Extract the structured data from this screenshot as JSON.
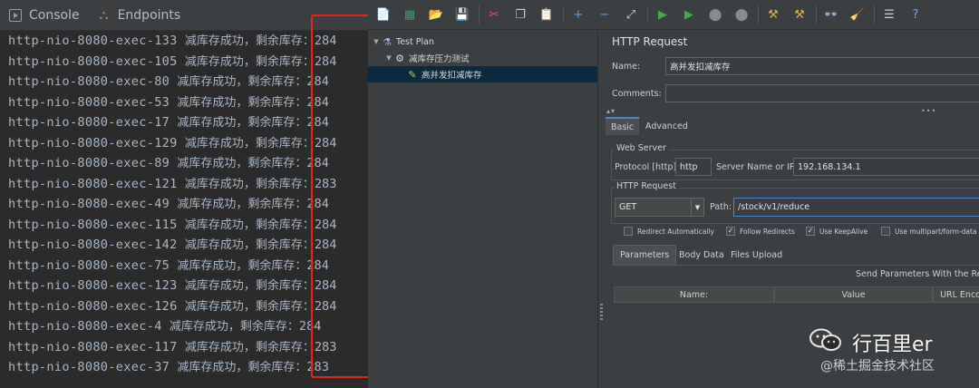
{
  "ide": {
    "tabs": [
      {
        "label": "Console",
        "icon": "console-icon"
      },
      {
        "label": "Endpoints",
        "icon": "endpoints-icon"
      }
    ],
    "console_lines": [
      {
        "thread": "http-nio-8080-exec-133",
        "message": "减库存成功，剩余库存：",
        "stock": "284"
      },
      {
        "thread": "http-nio-8080-exec-105",
        "message": "减库存成功，剩余库存：",
        "stock": "284"
      },
      {
        "thread": "http-nio-8080-exec-80",
        "message": "减库存成功，剩余库存：",
        "stock": "284"
      },
      {
        "thread": "http-nio-8080-exec-53",
        "message": "减库存成功，剩余库存：",
        "stock": "284"
      },
      {
        "thread": "http-nio-8080-exec-17",
        "message": "减库存成功，剩余库存：",
        "stock": "284"
      },
      {
        "thread": "http-nio-8080-exec-129",
        "message": "减库存成功，剩余库存：",
        "stock": "284"
      },
      {
        "thread": "http-nio-8080-exec-89",
        "message": "减库存成功，剩余库存：",
        "stock": "284"
      },
      {
        "thread": "http-nio-8080-exec-121",
        "message": "减库存成功，剩余库存：",
        "stock": "283"
      },
      {
        "thread": "http-nio-8080-exec-49",
        "message": "减库存成功，剩余库存：",
        "stock": "284"
      },
      {
        "thread": "http-nio-8080-exec-115",
        "message": "减库存成功，剩余库存：",
        "stock": "284"
      },
      {
        "thread": "http-nio-8080-exec-142",
        "message": "减库存成功，剩余库存：",
        "stock": "284"
      },
      {
        "thread": "http-nio-8080-exec-75",
        "message": "减库存成功，剩余库存：",
        "stock": "284"
      },
      {
        "thread": "http-nio-8080-exec-123",
        "message": "减库存成功，剩余库存：",
        "stock": "284"
      },
      {
        "thread": "http-nio-8080-exec-126",
        "message": "减库存成功，剩余库存：",
        "stock": "284"
      },
      {
        "thread": "http-nio-8080-exec-4",
        "message": "减库存成功，剩余库存：",
        "stock": "284"
      },
      {
        "thread": "http-nio-8080-exec-117",
        "message": "减库存成功，剩余库存：",
        "stock": "283"
      },
      {
        "thread": "http-nio-8080-exec-37",
        "message": "减库存成功，剩余库存：",
        "stock": "283"
      }
    ],
    "highlight_color": "#e8231d"
  },
  "jmeter": {
    "toolbar_icons": [
      "new-icon",
      "templates-icon",
      "open-icon",
      "save-icon",
      "cut-icon",
      "copy-icon",
      "paste-icon",
      "expand-icon",
      "collapse-icon",
      "toggle-icon",
      "start-icon",
      "start-no-pauses-icon",
      "stop-icon",
      "shutdown-icon",
      "clear-icon",
      "clear-all-icon",
      "search-icon",
      "reset-search-icon",
      "function-helper-icon",
      "help-icon"
    ],
    "tree": [
      {
        "label": "Test Plan",
        "icon": "test-plan-icon",
        "level": 0
      },
      {
        "label": "减库存压力测试",
        "icon": "thread-group-icon",
        "level": 1
      },
      {
        "label": "高并发扣减库存",
        "icon": "sampler-icon",
        "level": 2,
        "selected": true
      }
    ],
    "form": {
      "title": "HTTP Request",
      "name_label": "Name:",
      "name_value": "高并发扣减库存",
      "comments_label": "Comments:",
      "comments_value": "",
      "tabs": [
        "Basic",
        "Advanced"
      ],
      "web_server_legend": "Web Server",
      "protocol_label": "Protocol [http]:",
      "protocol_value": "http",
      "server_label": "Server Name or IP:",
      "server_value": "192.168.134.1",
      "http_request_legend": "HTTP Request",
      "method_value": "GET",
      "path_label": "Path:",
      "path_value": "/stock/v1/reduce",
      "checkboxes": [
        {
          "label": "Redirect Automatically",
          "checked": false
        },
        {
          "label": "Follow Redirects",
          "checked": true
        },
        {
          "label": "Use KeepAlive",
          "checked": true
        },
        {
          "label": "Use multipart/form-data",
          "checked": false
        }
      ],
      "sub_tabs": [
        "Parameters",
        "Body Data",
        "Files Upload"
      ],
      "send_params_label": "Send Parameters With the Requ",
      "columns": [
        "Name:",
        "Value",
        "URL Enco"
      ]
    }
  },
  "watermark": {
    "name": "行百里er",
    "sub": "@稀土掘金技术社区"
  }
}
